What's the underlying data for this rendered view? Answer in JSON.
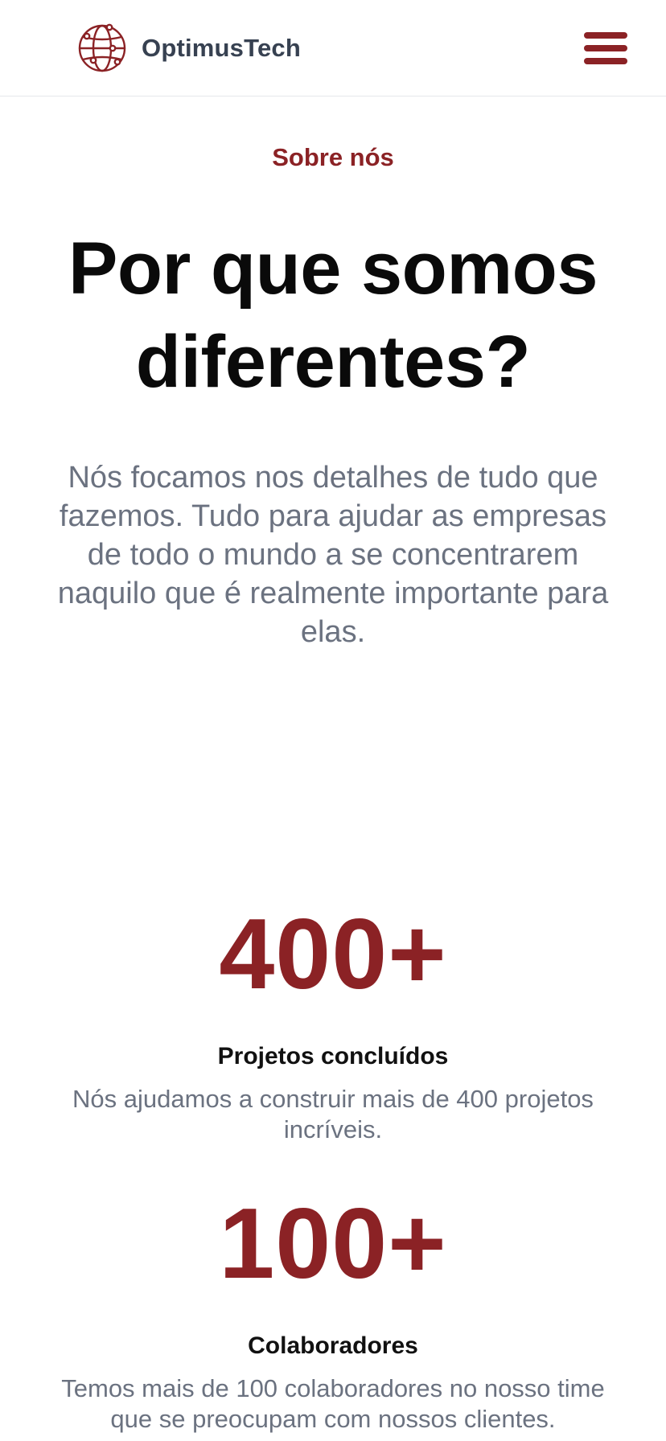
{
  "header": {
    "brand_name": "OptimusTech",
    "logo_icon": "globe-network-icon",
    "menu_icon": "hamburger-menu-icon"
  },
  "hero": {
    "eyebrow": "Sobre nós",
    "headline": "Por que somos diferentes?",
    "lead": "Nós focamos nos detalhes de tudo que fazemos. Tudo para ajudar as empresas de todo o mundo a se concentrarem naquilo que é realmente importante para elas."
  },
  "stats": [
    {
      "number": "400+",
      "title": "Projetos concluídos",
      "description": "Nós ajudamos a construir mais de 400 projetos incríveis."
    },
    {
      "number": "100+",
      "title": "Colaboradores",
      "description": "Temos mais de 100 colaboradores no nosso time que se preocupam com nossos clientes."
    }
  ],
  "colors": {
    "accent": "#8b2225",
    "heading": "#0a0a0a",
    "muted_text": "#6b7280",
    "brand_text": "#374151"
  }
}
